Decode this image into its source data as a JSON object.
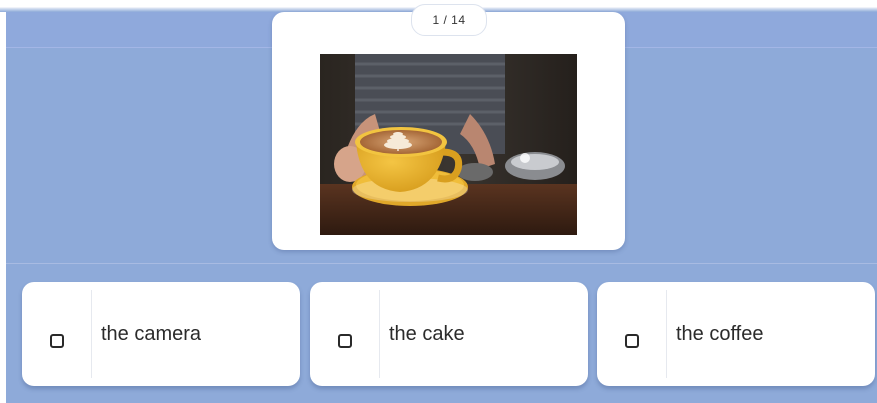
{
  "progress": {
    "counter": "1 / 14",
    "current": 1,
    "total": 14
  },
  "question": {
    "image_icon": "latte-art-coffee-cup-photo"
  },
  "options": [
    {
      "label": "the camera",
      "icon": "checkbox-icon"
    },
    {
      "label": "the cake",
      "icon": "checkbox-icon"
    },
    {
      "label": "the coffee",
      "icon": "checkbox-icon"
    }
  ],
  "colors": {
    "background": "#8eaad9",
    "card": "#ffffff",
    "text": "#2b2b2b"
  }
}
